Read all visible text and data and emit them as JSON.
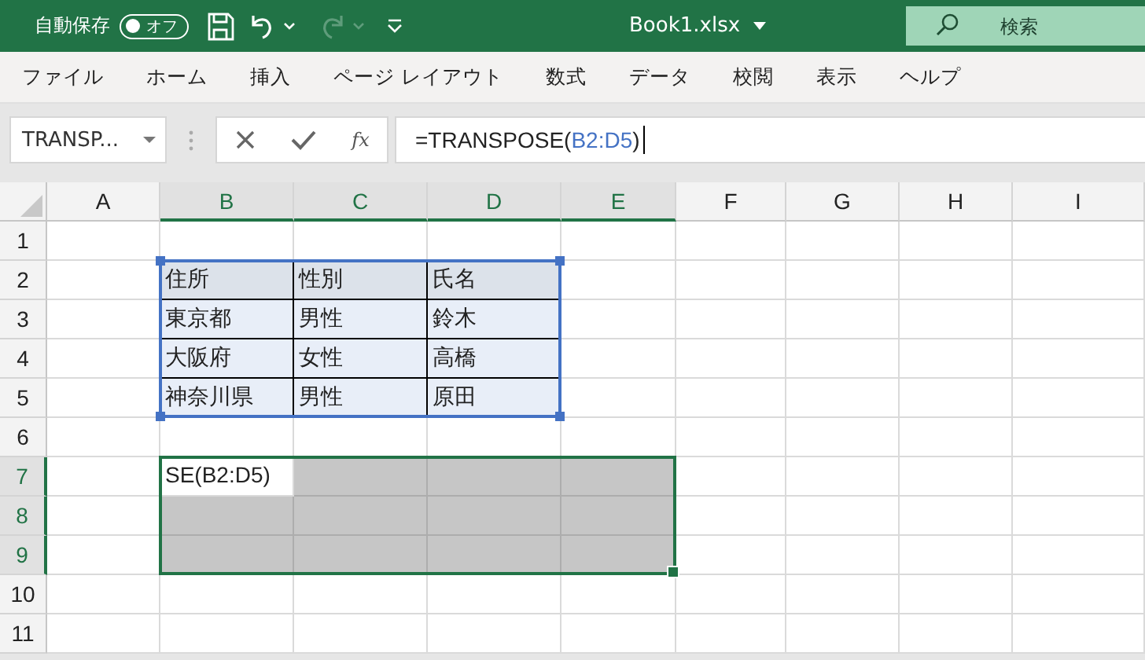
{
  "title_bar": {
    "autosave": {
      "label": "自動保存",
      "state_text": "オフ",
      "on": false
    },
    "redo": {
      "disabled": true
    },
    "title": "Book1.xlsx",
    "search": {
      "placeholder": "検索"
    }
  },
  "ribbon_tabs": [
    "ファイル",
    "ホーム",
    "挿入",
    "ページ レイアウト",
    "数式",
    "データ",
    "校閲",
    "表示",
    "ヘルプ"
  ],
  "formula_bar": {
    "name_box": "TRANSP...",
    "function_label": "fx",
    "formula": [
      {
        "text": "=TRANSPOSE(",
        "kind": "plain"
      },
      {
        "text": "B2:D5",
        "kind": "reference"
      },
      {
        "text": ")",
        "kind": "plain"
      }
    ]
  },
  "sheet": {
    "columns": [
      {
        "label": "A",
        "selected": false
      },
      {
        "label": "B",
        "selected": true
      },
      {
        "label": "C",
        "selected": true
      },
      {
        "label": "D",
        "selected": true
      },
      {
        "label": "E",
        "selected": true
      },
      {
        "label": "F",
        "selected": false
      },
      {
        "label": "G",
        "selected": false
      },
      {
        "label": "H",
        "selected": false
      },
      {
        "label": "I",
        "selected": false
      }
    ],
    "rows": [
      {
        "label": "1",
        "selected": false,
        "cells": [
          {
            "kind": "plain",
            "selected": false
          },
          {
            "kind": "plain",
            "selected": false
          },
          {
            "kind": "plain",
            "selected": false
          },
          {
            "kind": "plain",
            "selected": false
          },
          {
            "kind": "plain",
            "selected": false
          },
          {
            "kind": "plain",
            "selected": false
          },
          {
            "kind": "plain",
            "selected": false
          },
          {
            "kind": "plain",
            "selected": false
          },
          {
            "kind": "plain",
            "selected": false
          }
        ]
      },
      {
        "label": "2",
        "selected": false,
        "cells": [
          {
            "kind": "plain",
            "selected": false
          },
          {
            "kind": "table-header",
            "selected": false,
            "text": "住所"
          },
          {
            "kind": "table-header",
            "selected": false,
            "text": "性別"
          },
          {
            "kind": "table-header",
            "selected": false,
            "text": "氏名"
          },
          {
            "kind": "plain",
            "selected": false
          },
          {
            "kind": "plain",
            "selected": false
          },
          {
            "kind": "plain",
            "selected": false
          },
          {
            "kind": "plain",
            "selected": false
          },
          {
            "kind": "plain",
            "selected": false
          }
        ]
      },
      {
        "label": "3",
        "selected": false,
        "cells": [
          {
            "kind": "plain",
            "selected": false
          },
          {
            "kind": "table-body",
            "selected": false,
            "text": "東京都"
          },
          {
            "kind": "table-body",
            "selected": false,
            "text": "男性"
          },
          {
            "kind": "table-body",
            "selected": false,
            "text": "鈴木"
          },
          {
            "kind": "plain",
            "selected": false
          },
          {
            "kind": "plain",
            "selected": false
          },
          {
            "kind": "plain",
            "selected": false
          },
          {
            "kind": "plain",
            "selected": false
          },
          {
            "kind": "plain",
            "selected": false
          }
        ]
      },
      {
        "label": "4",
        "selected": false,
        "cells": [
          {
            "kind": "plain",
            "selected": false
          },
          {
            "kind": "table-body",
            "selected": false,
            "text": "大阪府"
          },
          {
            "kind": "table-body",
            "selected": false,
            "text": "女性"
          },
          {
            "kind": "table-body",
            "selected": false,
            "text": "高橋"
          },
          {
            "kind": "plain",
            "selected": false
          },
          {
            "kind": "plain",
            "selected": false
          },
          {
            "kind": "plain",
            "selected": false
          },
          {
            "kind": "plain",
            "selected": false
          },
          {
            "kind": "plain",
            "selected": false
          }
        ]
      },
      {
        "label": "5",
        "selected": false,
        "cells": [
          {
            "kind": "plain",
            "selected": false
          },
          {
            "kind": "table-body",
            "selected": false,
            "text": "神奈川県"
          },
          {
            "kind": "table-body",
            "selected": false,
            "text": "男性"
          },
          {
            "kind": "table-body",
            "selected": false,
            "text": "原田"
          },
          {
            "kind": "plain",
            "selected": false
          },
          {
            "kind": "plain",
            "selected": false
          },
          {
            "kind": "plain",
            "selected": false
          },
          {
            "kind": "plain",
            "selected": false
          },
          {
            "kind": "plain",
            "selected": false
          }
        ]
      },
      {
        "label": "6",
        "selected": false,
        "cells": [
          {
            "kind": "plain",
            "selected": false
          },
          {
            "kind": "plain",
            "selected": false
          },
          {
            "kind": "plain",
            "selected": false
          },
          {
            "kind": "plain",
            "selected": false
          },
          {
            "kind": "plain",
            "selected": false
          },
          {
            "kind": "plain",
            "selected": false
          },
          {
            "kind": "plain",
            "selected": false
          },
          {
            "kind": "plain",
            "selected": false
          },
          {
            "kind": "plain",
            "selected": false
          }
        ]
      },
      {
        "label": "7",
        "selected": true,
        "cells": [
          {
            "kind": "plain",
            "selected": false
          },
          {
            "kind": "active",
            "selected": true,
            "text": "SE(B2:D5)"
          },
          {
            "kind": "plain",
            "selected": true
          },
          {
            "kind": "plain",
            "selected": true
          },
          {
            "kind": "plain",
            "selected": true
          },
          {
            "kind": "plain",
            "selected": false
          },
          {
            "kind": "plain",
            "selected": false
          },
          {
            "kind": "plain",
            "selected": false
          },
          {
            "kind": "plain",
            "selected": false
          }
        ]
      },
      {
        "label": "8",
        "selected": true,
        "cells": [
          {
            "kind": "plain",
            "selected": false
          },
          {
            "kind": "plain",
            "selected": true
          },
          {
            "kind": "plain",
            "selected": true
          },
          {
            "kind": "plain",
            "selected": true
          },
          {
            "kind": "plain",
            "selected": true
          },
          {
            "kind": "plain",
            "selected": false
          },
          {
            "kind": "plain",
            "selected": false
          },
          {
            "kind": "plain",
            "selected": false
          },
          {
            "kind": "plain",
            "selected": false
          }
        ]
      },
      {
        "label": "9",
        "selected": true,
        "cells": [
          {
            "kind": "plain",
            "selected": false
          },
          {
            "kind": "plain",
            "selected": true
          },
          {
            "kind": "plain",
            "selected": true
          },
          {
            "kind": "plain",
            "selected": true
          },
          {
            "kind": "plain",
            "selected": true
          },
          {
            "kind": "plain",
            "selected": false
          },
          {
            "kind": "plain",
            "selected": false
          },
          {
            "kind": "plain",
            "selected": false
          },
          {
            "kind": "plain",
            "selected": false
          }
        ]
      },
      {
        "label": "10",
        "selected": false,
        "cells": [
          {
            "kind": "plain",
            "selected": false
          },
          {
            "kind": "plain",
            "selected": false
          },
          {
            "kind": "plain",
            "selected": false
          },
          {
            "kind": "plain",
            "selected": false
          },
          {
            "kind": "plain",
            "selected": false
          },
          {
            "kind": "plain",
            "selected": false
          },
          {
            "kind": "plain",
            "selected": false
          },
          {
            "kind": "plain",
            "selected": false
          },
          {
            "kind": "plain",
            "selected": false
          }
        ]
      },
      {
        "label": "11",
        "selected": false,
        "cells": [
          {
            "kind": "plain",
            "selected": false
          },
          {
            "kind": "plain",
            "selected": false
          },
          {
            "kind": "plain",
            "selected": false
          },
          {
            "kind": "plain",
            "selected": false
          },
          {
            "kind": "plain",
            "selected": false
          },
          {
            "kind": "plain",
            "selected": false
          },
          {
            "kind": "plain",
            "selected": false
          },
          {
            "kind": "plain",
            "selected": false
          },
          {
            "kind": "plain",
            "selected": false
          }
        ]
      }
    ]
  }
}
